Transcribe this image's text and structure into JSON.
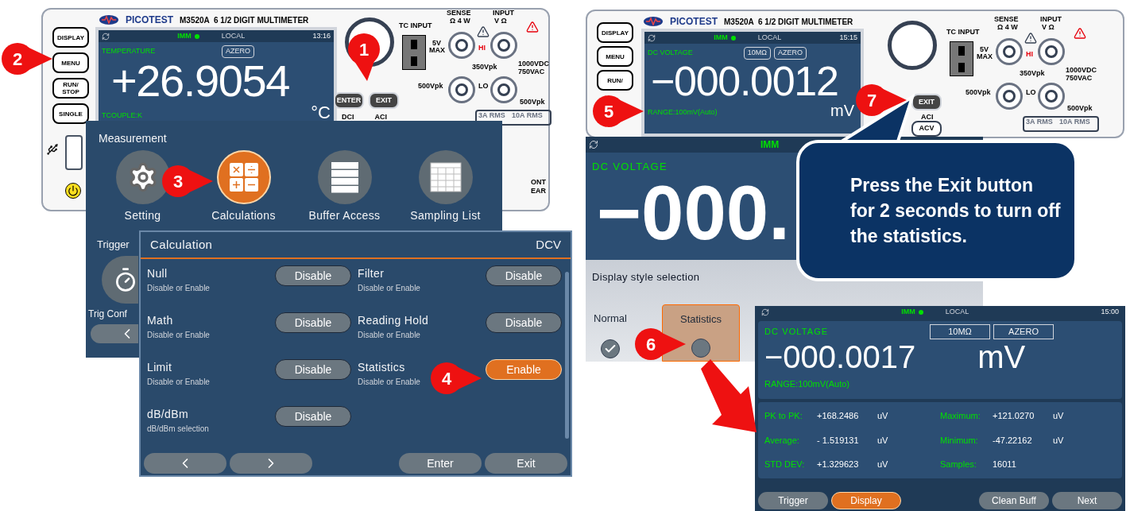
{
  "left_meter": {
    "brand": "PICOTEST",
    "model": "M3520A  6 1/2 DIGIT MULTIMETER",
    "side_keys": [
      {
        "lines": [
          "DISPLAY"
        ]
      },
      {
        "lines": [
          "MENU"
        ]
      },
      {
        "lines": [
          "RUN/",
          "STOP"
        ]
      },
      {
        "lines": [
          "SINGLE"
        ]
      }
    ],
    "screen": {
      "mode": "IMM",
      "remote": "LOCAL",
      "time": "13:16",
      "function": "TEMPERATURE",
      "tags": [
        "AZERO"
      ],
      "reading": "+26.9054",
      "sensor": "TCOUPLE:K",
      "unit": "°C"
    },
    "keys": [
      "ENTER",
      "EXIT"
    ],
    "key_captions": [
      "DCI",
      "ACI"
    ],
    "terminal_labels": [
      "TC INPUT",
      "5V",
      "MAX",
      "500Vpk",
      "SENSE",
      "Ω 4 W",
      "INPUT",
      "V Ω",
      "HI",
      "350Vpk",
      "1000VDC",
      "750VAC",
      "LO",
      "500Vpk",
      "3A RMS",
      "10A RMS"
    ],
    "edge_labels": [
      "ONT",
      "EAR"
    ]
  },
  "right_meter": {
    "brand": "PICOTEST",
    "model": "M3520A  6 1/2 DIGIT MULTIMETER",
    "side_keys": [
      {
        "lines": [
          "DISPLAY"
        ]
      },
      {
        "lines": [
          "MENU"
        ]
      },
      {
        "lines": [
          "RUN/"
        ]
      }
    ],
    "screen": {
      "mode": "IMM",
      "remote": "LOCAL",
      "time": "15:15",
      "function": "DC VOLTAGE",
      "tags": [
        "10MΩ",
        "AZERO"
      ],
      "reading": "−000.0012",
      "range": "RANGE:100mV(Auto)",
      "unit": "mV"
    },
    "keys": [
      "EXIT"
    ],
    "key_captions": [
      "ACI"
    ],
    "lower_keys": [
      "ACV"
    ],
    "terminal_labels": [
      "TC INPUT",
      "5V",
      "MAX",
      "500Vpk",
      "SENSE",
      "Ω 4 W",
      "INPUT",
      "V Ω",
      "HI",
      "350Vpk",
      "1000VDC",
      "750VAC",
      "LO",
      "500Vpk",
      "3A RMS",
      "10A RMS"
    ]
  },
  "measurement_menu": {
    "title": "Measurement",
    "items": [
      {
        "label": "Setting",
        "selected": false
      },
      {
        "label": "Calculations",
        "selected": true
      },
      {
        "label": "Buffer Access",
        "selected": false
      },
      {
        "label": "Sampling List",
        "selected": false
      }
    ],
    "section_2": "Trigger",
    "item_2": "Trig Conf"
  },
  "calculation": {
    "title": "Calculation",
    "mode": "DCV",
    "rows": [
      {
        "name": "Null",
        "hint": "Disable or Enable",
        "button": "Disable",
        "on": false
      },
      {
        "name": "Filter",
        "hint": "Disable or Enable",
        "button": "Disable",
        "on": false
      },
      {
        "name": "Math",
        "hint": "Disable or Enable",
        "button": "Disable",
        "on": false
      },
      {
        "name": "Reading Hold",
        "hint": "Disable or Enable",
        "button": "Disable",
        "on": false
      },
      {
        "name": "Limit",
        "hint": "Disable or Enable",
        "button": "Disable",
        "on": false
      },
      {
        "name": "Statistics",
        "hint": "Disable or Enable",
        "button": "Enable",
        "on": true
      },
      {
        "name": "dB/dBm",
        "hint": "dB/dBm selection",
        "button": "Disable",
        "on": false
      }
    ],
    "buttons": [
      "Enter",
      "Exit"
    ]
  },
  "display_screen": {
    "mode": "IMM",
    "function": "DC VOLTAGE",
    "reading": "−000.",
    "dialog": {
      "title": "Display style selection",
      "options": [
        {
          "label": "Normal",
          "selected": false,
          "checked": true
        },
        {
          "label": "Statistics",
          "selected": true,
          "checked": false
        }
      ]
    }
  },
  "callout": "Press the Exit button for 2 seconds to turn off the statistics.",
  "stats_screen": {
    "mode": "IMM",
    "remote": "LOCAL",
    "time": "15:00",
    "function": "DC VOLTAGE",
    "tags": [
      "10MΩ",
      "AZERO"
    ],
    "reading": "−000.0017",
    "unit": "mV",
    "range": "RANGE:100mV(Auto)",
    "stats": [
      {
        "label": "PK to PK:",
        "value": "+168.2486",
        "unit": "uV"
      },
      {
        "label": "Maximum:",
        "value": "+121.0270",
        "unit": "uV"
      },
      {
        "label": "Average:",
        "value": "- 1.519131",
        "unit": "uV"
      },
      {
        "label": "Minimum:",
        "value": "-47.22162",
        "unit": "uV"
      },
      {
        "label": "STD DEV:",
        "value": "+1.329623",
        "unit": "uV"
      },
      {
        "label": "Samples:",
        "value": "16011"
      }
    ],
    "buttons": [
      {
        "label": "Trigger",
        "selected": false
      },
      {
        "label": "Display",
        "selected": true
      },
      {
        "label": "Clean Buff",
        "selected": false
      },
      {
        "label": "Next",
        "selected": false
      }
    ]
  },
  "steps": [
    "1",
    "2",
    "3",
    "4",
    "5",
    "6",
    "7"
  ]
}
